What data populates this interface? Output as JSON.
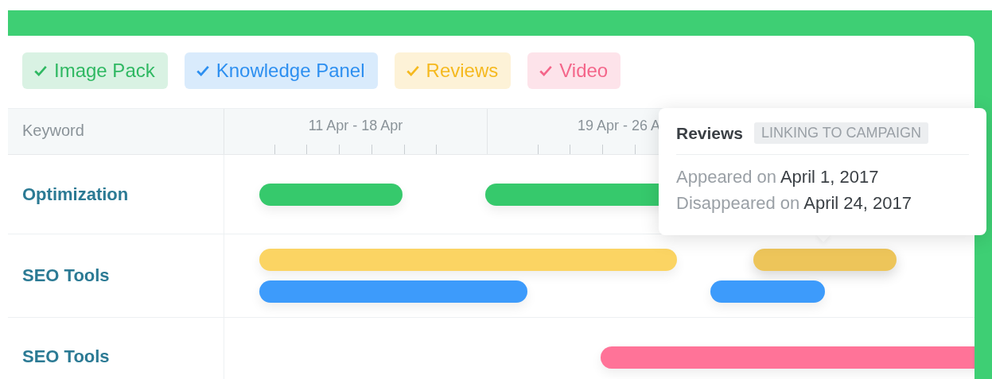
{
  "filters": [
    {
      "label": "Image Pack",
      "checked": true,
      "color": "#2fb862"
    },
    {
      "label": "Knowledge Panel",
      "checked": true,
      "color": "#2d8ff0"
    },
    {
      "label": "Reviews",
      "checked": true,
      "color": "#f5b91f"
    },
    {
      "label": "Video",
      "checked": true,
      "color": "#f4668a"
    }
  ],
  "table": {
    "keyword_heading": "Keyword",
    "weeks": [
      "11 Apr - 18 Apr",
      "19 Apr - 26 A"
    ],
    "rows": [
      {
        "keyword": "Optimization",
        "lanes": [
          [
            {
              "color": "#36c96c",
              "selected": false
            },
            {
              "color": "#36c96c",
              "selected": false
            }
          ]
        ]
      },
      {
        "keyword": "SEO Tools",
        "lanes": [
          [
            {
              "color": "#fbd463",
              "selected": false
            },
            {
              "color": "#edc55a",
              "selected": true
            }
          ],
          [
            {
              "color": "#3d9bfb",
              "selected": false
            },
            {
              "color": "#3d9bfb",
              "selected": false
            }
          ]
        ]
      },
      {
        "keyword": "SEO Tools",
        "lanes": [
          [
            {
              "color": "#ff7398",
              "selected": false
            }
          ]
        ]
      }
    ]
  },
  "tooltip": {
    "title": "Reviews",
    "badge": "LINKING TO CAMPAIGN",
    "lines": [
      "Appeared on **April 1, 2017**",
      "Disappeared on **April 24, 2017**"
    ]
  }
}
